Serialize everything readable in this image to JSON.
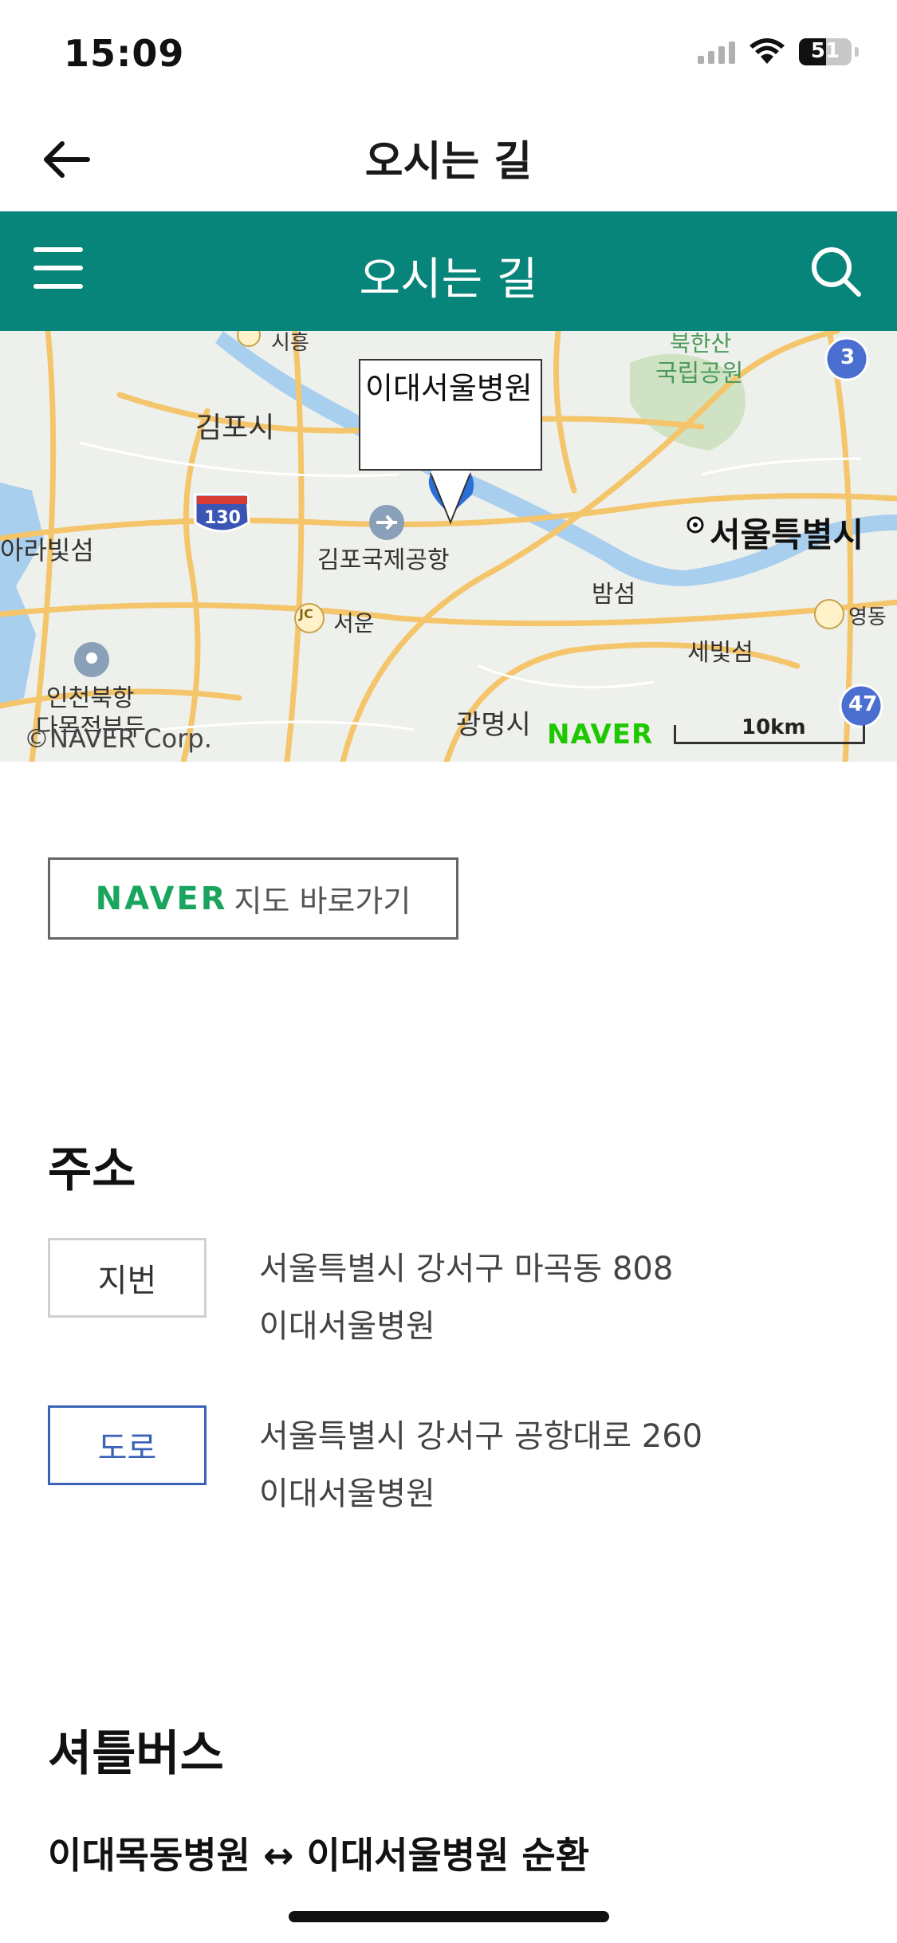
{
  "status_bar": {
    "time": "15:09",
    "battery": "51",
    "battery_level": 0.51
  },
  "header": {
    "title": "오시는 길"
  },
  "teal_bar": {
    "title": "오시는 길"
  },
  "map": {
    "callout": "이대서울병원",
    "labels": {
      "gimpo_si": "김포시",
      "gimpo_airport": "김포국제공항",
      "seoul": "서울특별시",
      "ara": "아라빛섬",
      "incheon": "인천북항",
      "incheon2": "다목적부두",
      "seoun": "서운",
      "bamseom": "밤섬",
      "sebit": "세빛섬",
      "gwangmyeong": "광명시",
      "bukhan": "북한산",
      "bukhan2": "국립공원",
      "yeongdong": "영동",
      "top": "시흥",
      "route_130": "130",
      "route_3": "3",
      "route_47": "47",
      "jc": "JC"
    },
    "copyright": "©NAVER Corp.",
    "logo": "NAVER",
    "scale": "10km"
  },
  "naver_button": {
    "brand": "NAVER",
    "text": "지도 바로가기"
  },
  "address": {
    "title": "주소",
    "jibun_label": "지번",
    "jibun_line1": "서울특별시 강서구 마곡동 808",
    "jibun_line2": "이대서울병원",
    "road_label": "도로",
    "road_line1": "서울특별시 강서구 공항대로 260",
    "road_line2": "이대서울병원"
  },
  "shuttle": {
    "title": "셔틀버스",
    "route": "이대목동병원 ↔ 이대서울병원 순환"
  },
  "colors": {
    "teal": "#07857a",
    "naver_green": "#1aa55f",
    "road_blue": "#3a62b8"
  }
}
